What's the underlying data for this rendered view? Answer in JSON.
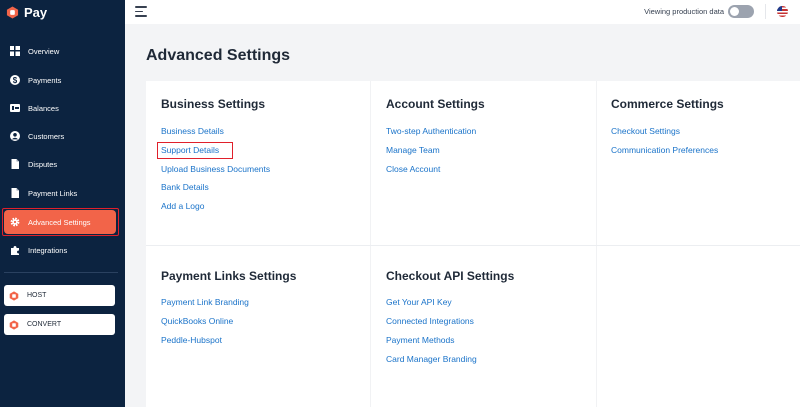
{
  "brand": {
    "name": "Pay"
  },
  "sidebar": {
    "items": [
      {
        "label": "Overview",
        "icon": "grid-icon"
      },
      {
        "label": "Payments",
        "icon": "dollar-icon"
      },
      {
        "label": "Balances",
        "icon": "wallet-icon"
      },
      {
        "label": "Customers",
        "icon": "user-icon"
      },
      {
        "label": "Disputes",
        "icon": "document-icon"
      },
      {
        "label": "Payment Links",
        "icon": "document-icon"
      },
      {
        "label": "Advanced Settings",
        "icon": "gear-icon",
        "active": true
      },
      {
        "label": "Integrations",
        "icon": "puzzle-icon"
      }
    ],
    "apps": [
      {
        "label": "HOST"
      },
      {
        "label": "CONVERT"
      }
    ]
  },
  "topbar": {
    "production_label": "Viewing production data"
  },
  "page": {
    "title": "Advanced Settings"
  },
  "sections": {
    "business": {
      "title": "Business Settings",
      "links": [
        "Business Details",
        "Support Details",
        "Upload Business Documents",
        "Bank Details",
        "Add a Logo"
      ]
    },
    "account": {
      "title": "Account Settings",
      "links": [
        "Two-step Authentication",
        "Manage Team",
        "Close Account"
      ]
    },
    "commerce": {
      "title": "Commerce Settings",
      "links": [
        "Checkout Settings",
        "Communication Preferences"
      ]
    },
    "payment_links": {
      "title": "Payment Links Settings",
      "links": [
        "Payment Link Branding",
        "QuickBooks Online",
        "Peddle-Hubspot"
      ]
    },
    "checkout_api": {
      "title": "Checkout API Settings",
      "links": [
        "Get Your API Key",
        "Connected Integrations",
        "Payment Methods",
        "Card Manager Branding"
      ]
    }
  },
  "colors": {
    "sidebar_bg": "#0c2340",
    "accent": "#f26449",
    "link": "#1a73c9",
    "highlight": "#e0202b"
  }
}
